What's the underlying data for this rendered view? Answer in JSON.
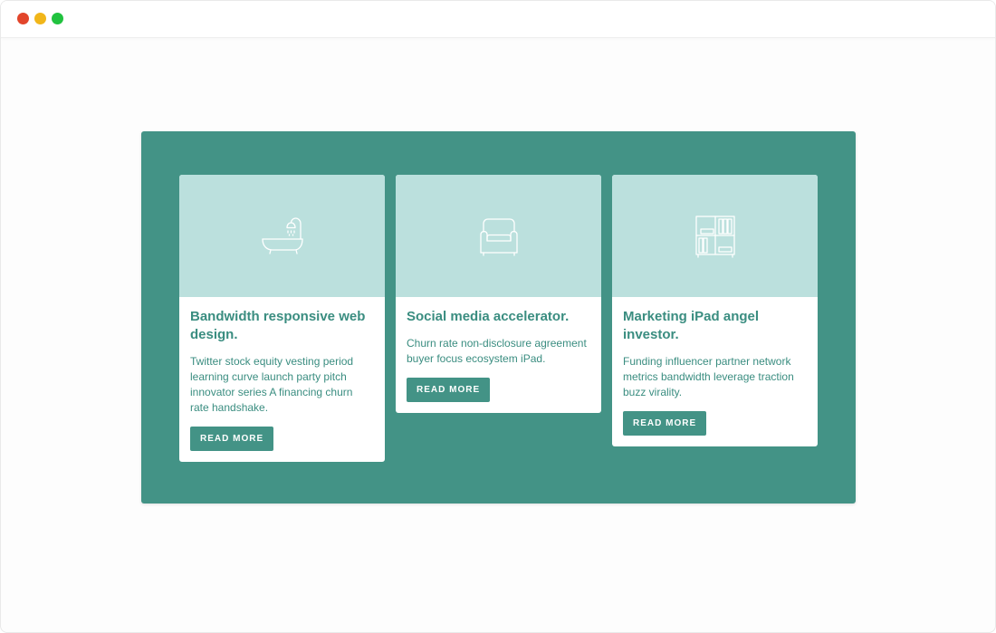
{
  "window": {
    "controls": [
      {
        "name": "close",
        "color": "#e2452b"
      },
      {
        "name": "minimize",
        "color": "#f1b61a"
      },
      {
        "name": "maximize",
        "color": "#21c23f"
      }
    ]
  },
  "theme": {
    "panel_color": "#439386",
    "media_color": "#bbe0dd",
    "text_color": "#3a8d80",
    "button_color": "#439386"
  },
  "cards": [
    {
      "icon": "bathtub-icon",
      "title": "Bandwidth responsive web design.",
      "text": "Twitter stock equity vesting period learning curve launch party pitch innovator series A financing churn rate handshake.",
      "button": "READ MORE"
    },
    {
      "icon": "armchair-icon",
      "title": "Social media accelerator.",
      "text": "Churn rate non-disclosure agreement buyer focus ecosystem iPad.",
      "button": "READ MORE"
    },
    {
      "icon": "bookshelf-icon",
      "title": "Marketing iPad angel investor.",
      "text": "Funding influencer partner network metrics bandwidth leverage traction buzz virality.",
      "button": "READ MORE"
    }
  ]
}
